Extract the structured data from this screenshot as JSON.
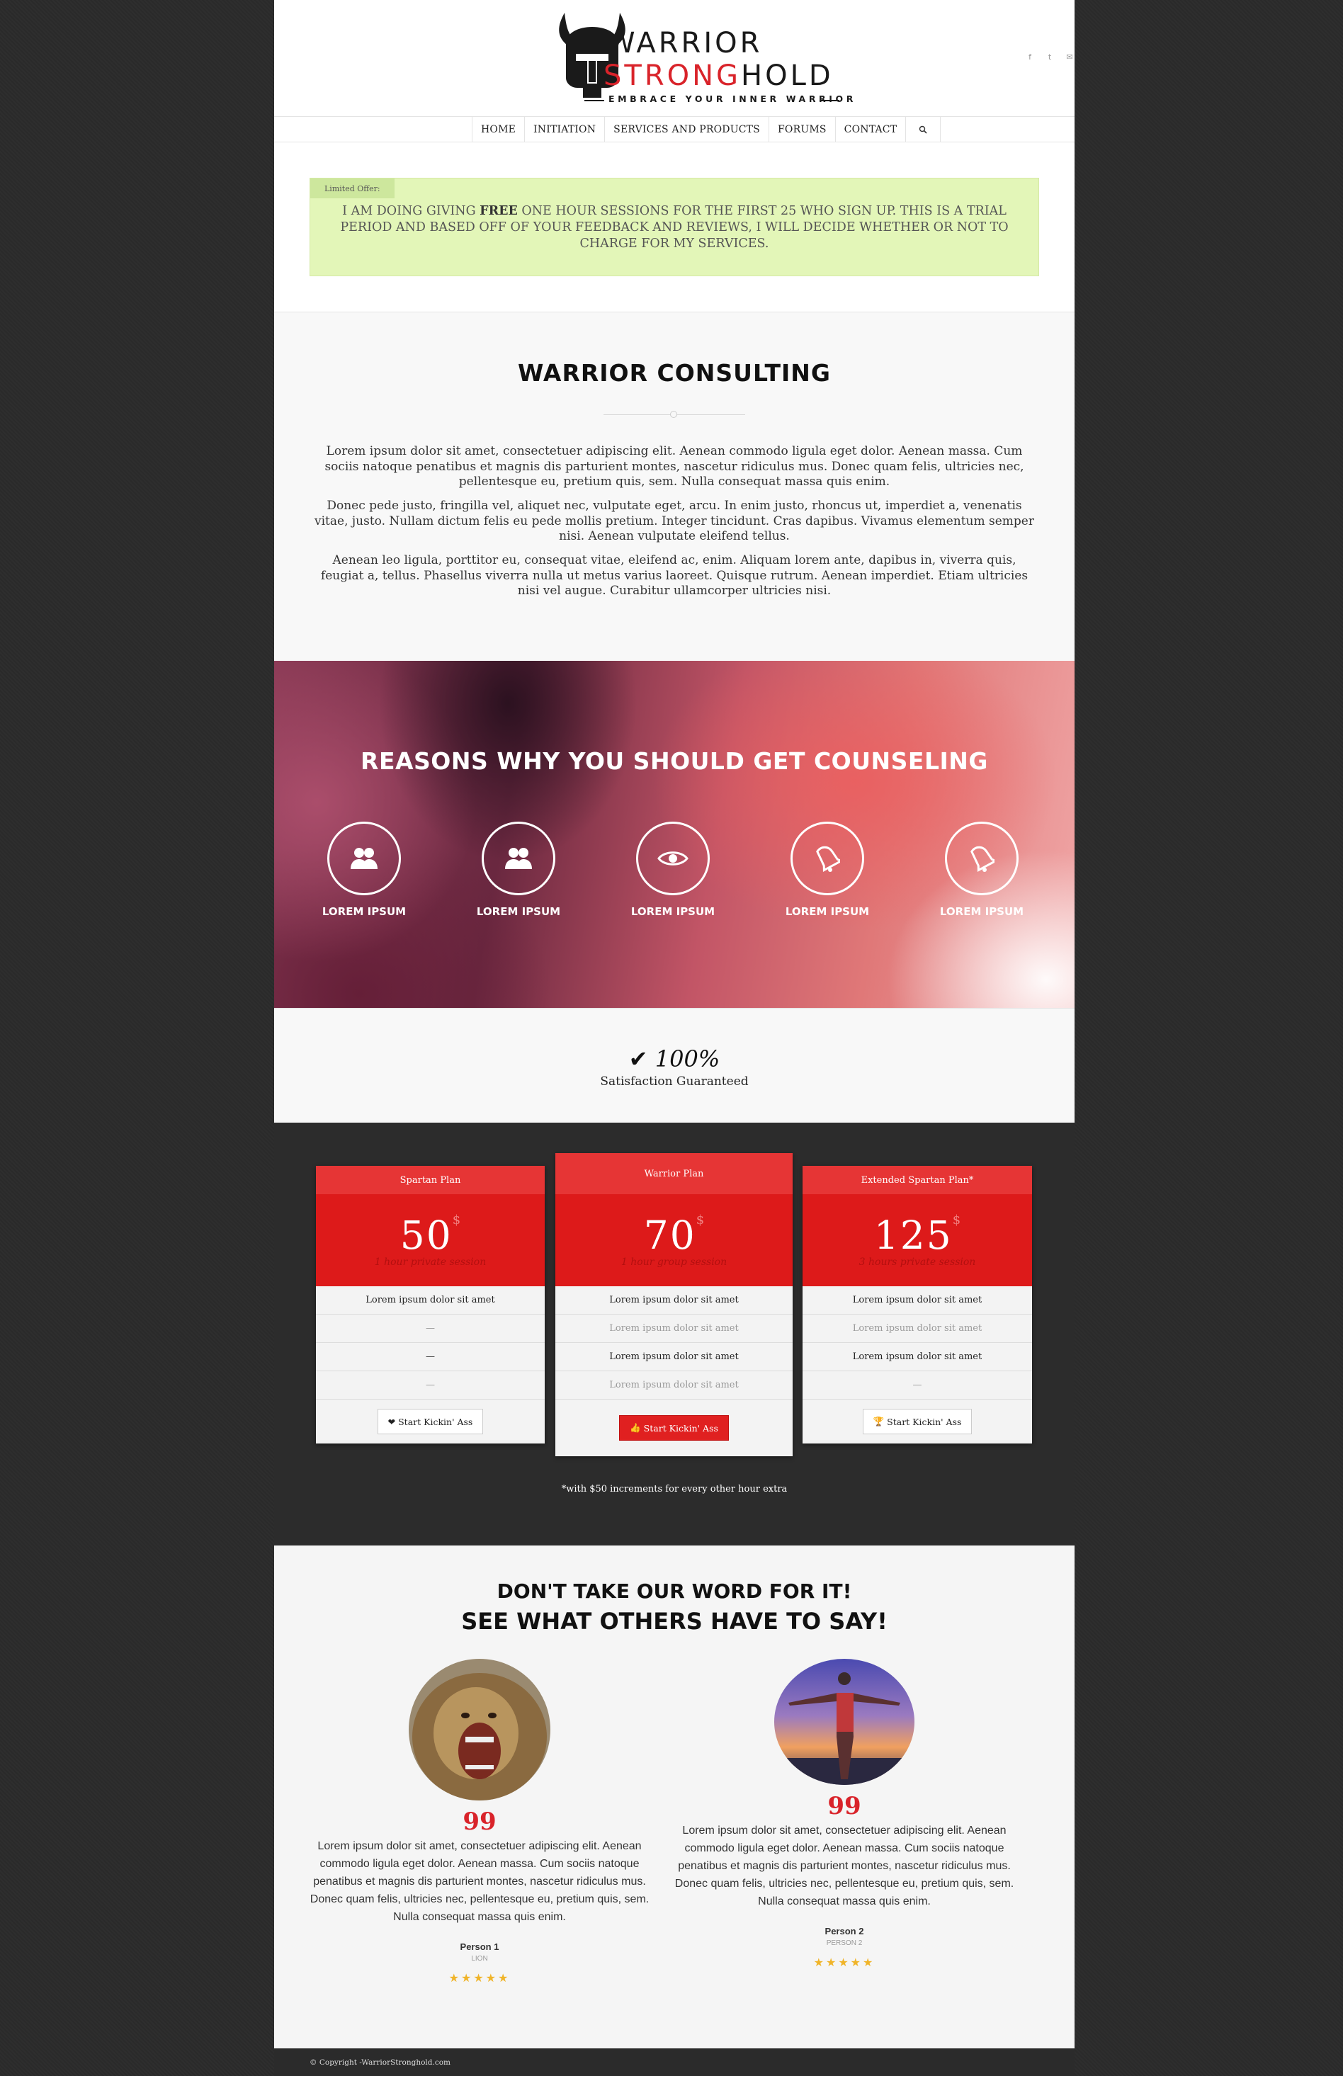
{
  "brand": {
    "line1": "WARRIOR",
    "line2_red": "STRONG",
    "line2_black": "HOLD",
    "tagline": "EMBRACE YOUR INNER WARRIOR"
  },
  "social": {
    "facebook": "f",
    "twitter": "t",
    "mail": "✉"
  },
  "nav": {
    "home": "HOME",
    "initiation": "INITIATION",
    "services": "SERVICES AND PRODUCTS",
    "forums": "FORUMS",
    "contact": "CONTACT",
    "search_icon": "search-icon"
  },
  "offer": {
    "tag": "Limited Offer:",
    "before": "I AM DOING GIVING ",
    "bold": "FREE",
    "after": " ONE HOUR SESSIONS FOR THE FIRST 25 WHO SIGN UP. THIS IS A TRIAL PERIOD AND BASED OFF OF YOUR FEEDBACK AND REVIEWS, I WILL DECIDE WHETHER OR NOT TO CHARGE FOR MY SERVICES."
  },
  "consulting": {
    "title": "WARRIOR CONSULTING",
    "p1": "Lorem ipsum dolor sit amet, consectetuer adipiscing elit. Aenean commodo ligula eget dolor. Aenean massa. Cum sociis natoque penatibus et magnis dis parturient montes, nascetur ridiculus mus. Donec quam felis, ultricies nec, pellentesque eu, pretium quis, sem. Nulla consequat massa quis enim.",
    "p2": "Donec pede justo, fringilla vel, aliquet nec, vulputate eget, arcu. In enim justo, rhoncus ut, imperdiet a, venenatis vitae, justo. Nullam dictum felis eu pede mollis pretium. Integer tincidunt. Cras dapibus. Vivamus elementum semper nisi. Aenean vulputate eleifend tellus.",
    "p3": "Aenean leo ligula, porttitor eu, consequat vitae, eleifend ac, enim. Aliquam lorem ante, dapibus in, viverra quis, feugiat a, tellus. Phasellus viverra nulla ut metus varius laoreet. Quisque rutrum. Aenean imperdiet. Etiam ultricies nisi vel augue. Curabitur ullamcorper ultricies nisi."
  },
  "reasons": {
    "title": "REASONS WHY YOU SHOULD GET COUNSELING",
    "items": [
      {
        "label": "LOREM IPSUM",
        "icon": "users-icon"
      },
      {
        "label": "LOREM IPSUM",
        "icon": "users-icon"
      },
      {
        "label": "LOREM IPSUM",
        "icon": "eye-icon"
      },
      {
        "label": "LOREM IPSUM",
        "icon": "bell-icon"
      },
      {
        "label": "LOREM IPSUM",
        "icon": "bell-icon"
      }
    ]
  },
  "satisfaction": {
    "check": "✔",
    "percent": "100%",
    "label": "Satisfaction Guaranteed"
  },
  "pricing": {
    "plans": [
      {
        "name": "Spartan Plan",
        "price": "50",
        "currency": "$",
        "sub": "1 hour private session",
        "rows": [
          "Lorem ipsum dolor sit amet",
          "—",
          "—",
          "—"
        ],
        "button": "Start Kickin' Ass",
        "button_icon": "heart-icon"
      },
      {
        "name": "Warrior Plan",
        "price": "70",
        "currency": "$",
        "sub": "1 hour group session",
        "rows": [
          "Lorem ipsum dolor sit amet",
          "Lorem ipsum dolor sit amet",
          "Lorem ipsum dolor sit amet",
          "Lorem ipsum dolor sit amet"
        ],
        "button": "Start Kickin' Ass",
        "button_icon": "thumbs-up-icon"
      },
      {
        "name": "Extended Spartan Plan*",
        "price": "125",
        "currency": "$",
        "sub": "3 hours private session",
        "rows": [
          "Lorem ipsum dolor sit amet",
          "Lorem ipsum dolor sit amet",
          "Lorem ipsum dolor sit amet",
          "—"
        ],
        "button": "Start Kickin' Ass",
        "button_icon": "trophy-icon"
      }
    ],
    "note": "*with $50 increments for every other hour extra"
  },
  "testimonials": {
    "title1": "DON'T TAKE OUR WORD FOR IT!",
    "title2": "SEE WHAT OTHERS HAVE TO SAY!",
    "items": [
      {
        "quote_mark": "99",
        "text": "Lorem ipsum dolor sit amet, consectetuer adipiscing elit. Aenean commodo ligula eget dolor. Aenean massa. Cum sociis natoque penatibus et magnis dis parturient montes, nascetur ridiculus mus. Donec quam felis, ultricies nec, pellentesque eu, pretium quis, sem. Nulla consequat massa quis enim.",
        "name": "Person 1",
        "role": "LION",
        "stars": "★★★★★",
        "rating": 5
      },
      {
        "quote_mark": "99",
        "text": "Lorem ipsum dolor sit amet, consectetuer adipiscing elit. Aenean commodo ligula eget dolor. Aenean massa. Cum sociis natoque penatibus et magnis dis parturient montes, nascetur ridiculus mus. Donec quam felis, ultricies nec, pellentesque eu, pretium quis, sem. Nulla consequat massa quis enim.",
        "name": "Person 2",
        "role": "PERSON 2",
        "stars": "★★★★★",
        "rating": 5
      }
    ]
  },
  "footer": {
    "copyright": "© Copyright -WarriorStronghold.com"
  },
  "colors": {
    "accent": "#d9232a",
    "offer_bg": "#e3f6b8",
    "dark": "#2c2c2c"
  }
}
